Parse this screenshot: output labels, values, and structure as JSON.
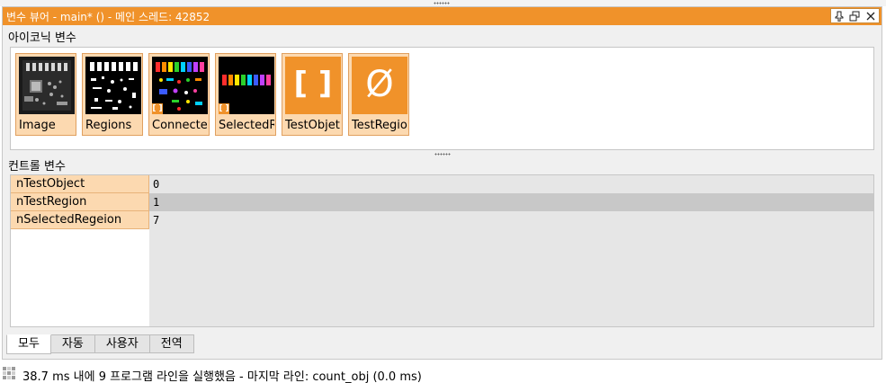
{
  "window": {
    "title": "변수 뷰어 - main* () - 메인 스레드: 42852",
    "pin_icon": "pin-icon",
    "float_icon": "float-window-icon",
    "close_icon": "close-icon",
    "accent_color": "#f0922a"
  },
  "iconic": {
    "section_label": "아이코닉 변수",
    "tiles": [
      {
        "label": "Image",
        "thumbnail": "grayscale-board-image"
      },
      {
        "label": "Regions",
        "thumbnail": "white-regions-on-black",
        "tuple_mark": ""
      },
      {
        "label": "Connected",
        "thumbnail": "colored-connected-regions",
        "tuple_mark": "[ ]"
      },
      {
        "label": "SelectedR",
        "thumbnail": "colored-selected-regions",
        "tuple_mark": "[ ]"
      },
      {
        "label": "TestObjet",
        "thumbnail": "empty-tuple",
        "symbol": "[ ]"
      },
      {
        "label": "TestRegio",
        "thumbnail": "empty-object",
        "symbol": "Ø"
      }
    ]
  },
  "control": {
    "section_label": "컨트롤 변수",
    "rows": [
      {
        "name": "nTestObject",
        "value": "0"
      },
      {
        "name": "nTestRegion",
        "value": "1"
      },
      {
        "name": "nSelectedRegeion",
        "value": "7"
      }
    ]
  },
  "tabs": [
    {
      "label": "모두",
      "active": true
    },
    {
      "label": "자동",
      "active": false
    },
    {
      "label": "사용자",
      "active": false
    },
    {
      "label": "전역",
      "active": false
    }
  ],
  "status": {
    "text": "38.7 ms 내에 9 프로그램 라인을 실행했음 - 마지막 라인: count_obj (0.0 ms)"
  }
}
